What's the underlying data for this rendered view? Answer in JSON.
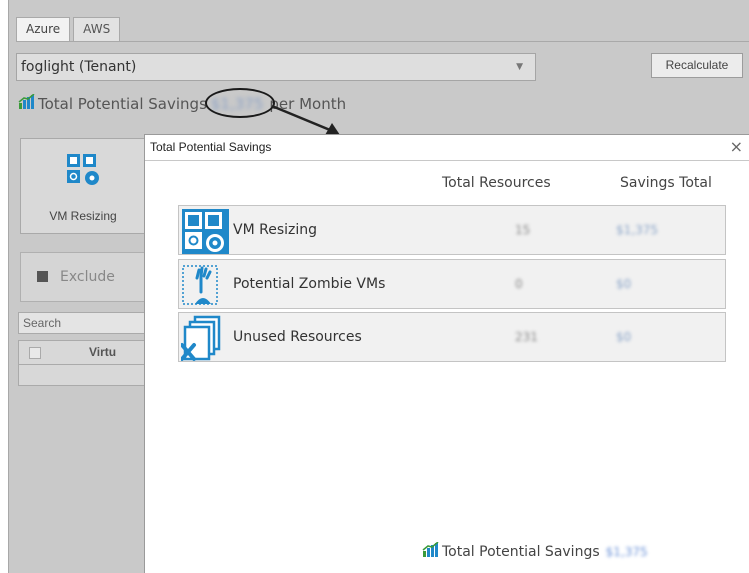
{
  "tabs": [
    {
      "label": "Azure",
      "active": true
    },
    {
      "label": "AWS",
      "active": false
    }
  ],
  "tenant_select": {
    "value": "foglight (Tenant)"
  },
  "recalculate_label": "Recalculate",
  "background_summary": {
    "prefix": "Total Potential Savings",
    "amount": "$1,375",
    "suffix": "per Month"
  },
  "side_panel": {
    "vm_resizing_label": "VM Resizing",
    "exclude_label": "Exclude",
    "search_placeholder": "Search",
    "grid_column": "Virtu"
  },
  "dialog": {
    "title": "Total Potential Savings",
    "close_glyph": "×",
    "headers": {
      "resources": "Total Resources",
      "savings": "Savings Total"
    },
    "rows": [
      {
        "name": "VM Resizing",
        "count": "15",
        "savings": "$1,375",
        "icon": "vm-resizing-icon"
      },
      {
        "name": "Potential Zombie VMs",
        "count": "0",
        "savings": "$0",
        "icon": "zombie-vm-icon"
      },
      {
        "name": "Unused Resources",
        "count": "231",
        "savings": "$0",
        "icon": "unused-resources-icon"
      }
    ],
    "total_label": "Total Potential Savings",
    "total_amount": "$1,375"
  },
  "colors": {
    "accent_blue": "#1f88c9",
    "chart_green": "#3a9a3a",
    "blurred_amount": "#6c93d8"
  }
}
